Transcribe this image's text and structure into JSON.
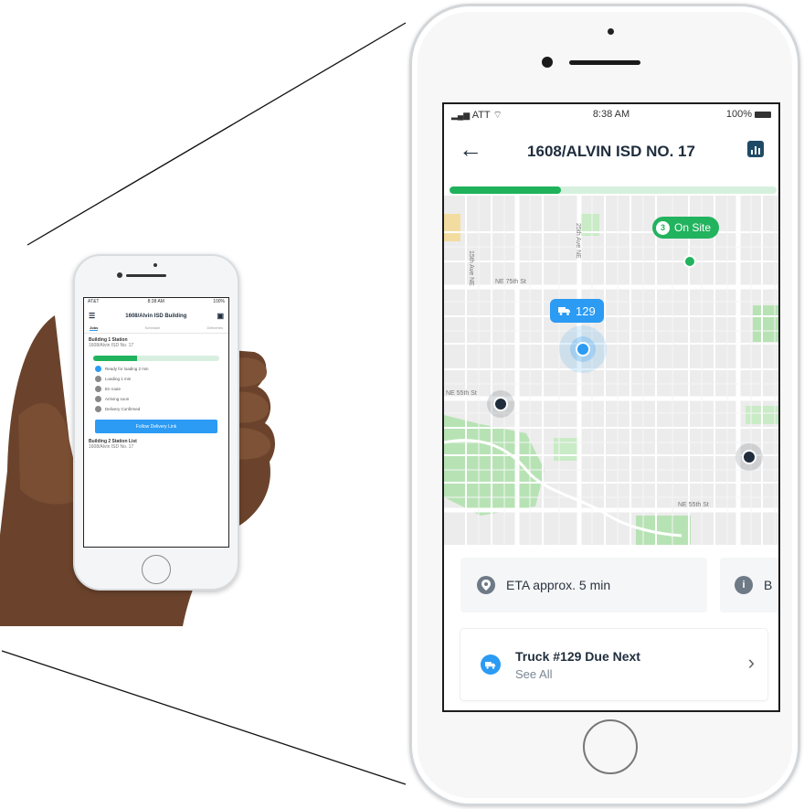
{
  "colors": {
    "accent_blue": "#2b9bf4",
    "success_green": "#22b35e",
    "progress_track": "#d6f0de",
    "title_dark": "#1f2d3d",
    "map_bg": "#eeeeee",
    "park_green": "#b7e3b4"
  },
  "small_phone": {
    "status": {
      "carrier": "AT&T",
      "time": "8:38 AM",
      "battery": "100%"
    },
    "header": {
      "title": "1608/Alvin ISD Building"
    },
    "tabs": [
      "Jobs",
      "Schedule",
      "Deliveries"
    ],
    "card": {
      "title": "Building 1 Station",
      "subtitle": "1608/Alvin ISD No. 17"
    },
    "progress": 0.35,
    "steps": [
      "Ready for loading 2 min",
      "Loading 1 min",
      "En route",
      "Arriving soon",
      "Delivery Confirmed"
    ],
    "button_label": "Follow Delivery Link",
    "card2": {
      "title": "Building 2 Station List",
      "subtitle": "1608/Alvin ISD No. 17"
    }
  },
  "app": {
    "status": {
      "carrier": "ATT",
      "time": "8:38 AM",
      "battery": "100%"
    },
    "title": "1608/ALVIN ISD NO. 17",
    "progress": 0.34,
    "map": {
      "on_site_count": "3",
      "on_site_label": "On Site",
      "truck_label": "129",
      "street_labels": [
        "NE 75th St",
        "NE 55th St",
        "NE 55th St",
        "15th Ave NE",
        "25th Ave NE"
      ]
    },
    "eta_card": {
      "text": "ETA approx. 5 min"
    },
    "second_card": {
      "text": "B"
    },
    "truck_card": {
      "title": "Truck #129 Due Next",
      "subtitle": "See All"
    }
  }
}
